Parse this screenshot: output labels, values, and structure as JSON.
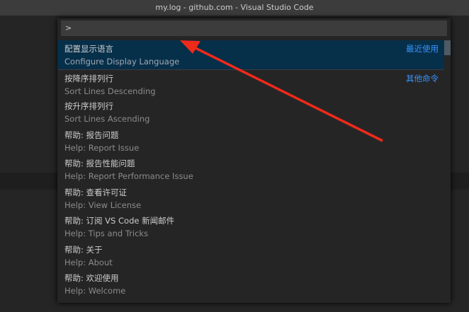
{
  "window": {
    "title": "my.log - github.com - Visual Studio Code"
  },
  "palette": {
    "input_value": ">",
    "items": [
      {
        "label": "配置显示语言",
        "detail": "Configure Display Language",
        "badge": "最近使用"
      },
      {
        "label": "按降序排列行",
        "detail": "Sort Lines Descending",
        "badge": "其他命令"
      },
      {
        "label": "按升序排列行",
        "detail": "Sort Lines Ascending"
      },
      {
        "label": "帮助: 报告问题",
        "detail": "Help: Report Issue"
      },
      {
        "label": "帮助: 报告性能问题",
        "detail": "Help: Report Performance Issue"
      },
      {
        "label": "帮助: 查看许可证",
        "detail": "Help: View License"
      },
      {
        "label": "帮助: 订阅 VS Code 新闻邮件",
        "detail": "Help: Tips and Tricks"
      },
      {
        "label": "帮助: 关于",
        "detail": "Help: About"
      },
      {
        "label": "帮助: 欢迎使用",
        "detail": "Help: Welcome"
      }
    ]
  },
  "colors": {
    "arrow": "#ee2a1a",
    "accent": "#3794ff",
    "selection": "#062f4a"
  }
}
